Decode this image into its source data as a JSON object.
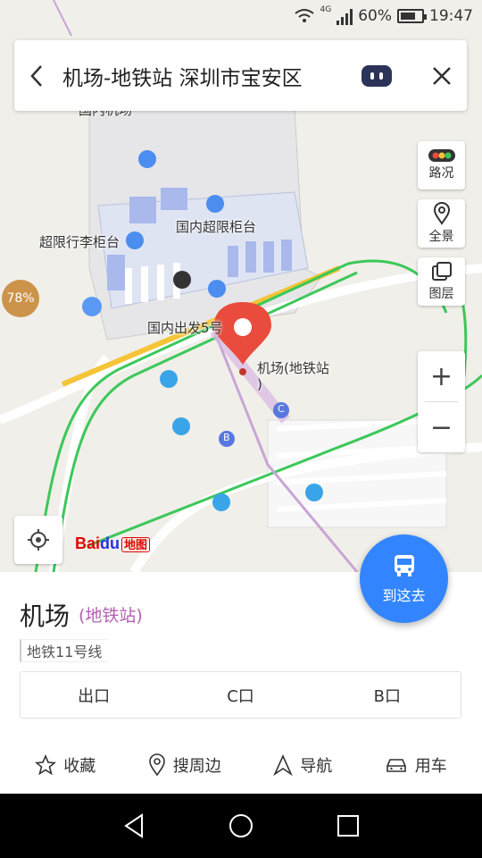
{
  "status_bar": {
    "network": "4G",
    "battery_pct": "60%",
    "battery_level": 0.6,
    "time": "19:47"
  },
  "search": {
    "query": "机场-地铁站 深圳市宝安区"
  },
  "map": {
    "labels": {
      "top_cut": "国内机场",
      "intl_counter": "国内超限柜台",
      "oversize_counter": "超限行李柜台",
      "departure": "国内出发5号",
      "station": "机场(地铁站",
      "station_paren": ")",
      "exit_c": "C",
      "exit_b": "B"
    },
    "traffic_pct": "78%",
    "accent_color": "#3385ff",
    "pin_color": "#e94b3c"
  },
  "tools": {
    "traffic": "路况",
    "panorama": "全景",
    "layers": "图层",
    "zoom_in": "+",
    "zoom_out": "−"
  },
  "logo": {
    "bai": "Bai",
    "du": "du",
    "ditu": "地图"
  },
  "route_button": "到这去",
  "place": {
    "name": "机场",
    "type": "(地铁站)",
    "line": "地铁11号线",
    "exits": [
      "出口",
      "C口",
      "B口"
    ]
  },
  "actions": [
    {
      "label": "收藏",
      "icon": "star-icon"
    },
    {
      "label": "搜周边",
      "icon": "location-pin-icon"
    },
    {
      "label": "导航",
      "icon": "navigation-arrow-icon"
    },
    {
      "label": "用车",
      "icon": "car-icon"
    }
  ]
}
